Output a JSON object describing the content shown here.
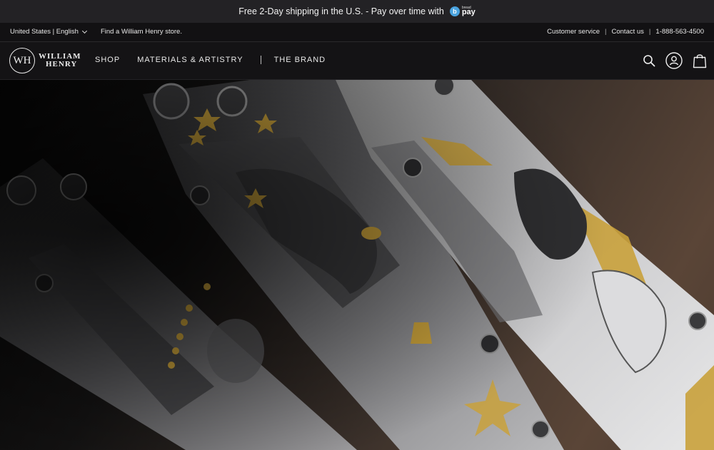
{
  "promo": {
    "text": "Free 2-Day shipping in the U.S. - Pay over time with",
    "bread_small": "bread",
    "bread_big": "pay",
    "bread_mark": "b"
  },
  "utility": {
    "locale": "United States | English",
    "store": "Find a William Henry store.",
    "customer_service": "Customer service",
    "contact": "Contact us",
    "phone": "1-888-563-4500",
    "sep": "|"
  },
  "nav": {
    "logo_mark": "WH",
    "logo_line1": "WILLIAM",
    "logo_line2": "HENRY",
    "items": [
      "SHOP",
      "MATERIALS & ARTISTRY",
      "THE BRAND"
    ]
  },
  "icons": [
    "search-icon",
    "account-icon",
    "bag-icon"
  ],
  "colors": {
    "promo_bg": "#232225",
    "nav_bg": "#141315",
    "bread_blue": "#4aa3df",
    "gold": "#c9a13b"
  }
}
